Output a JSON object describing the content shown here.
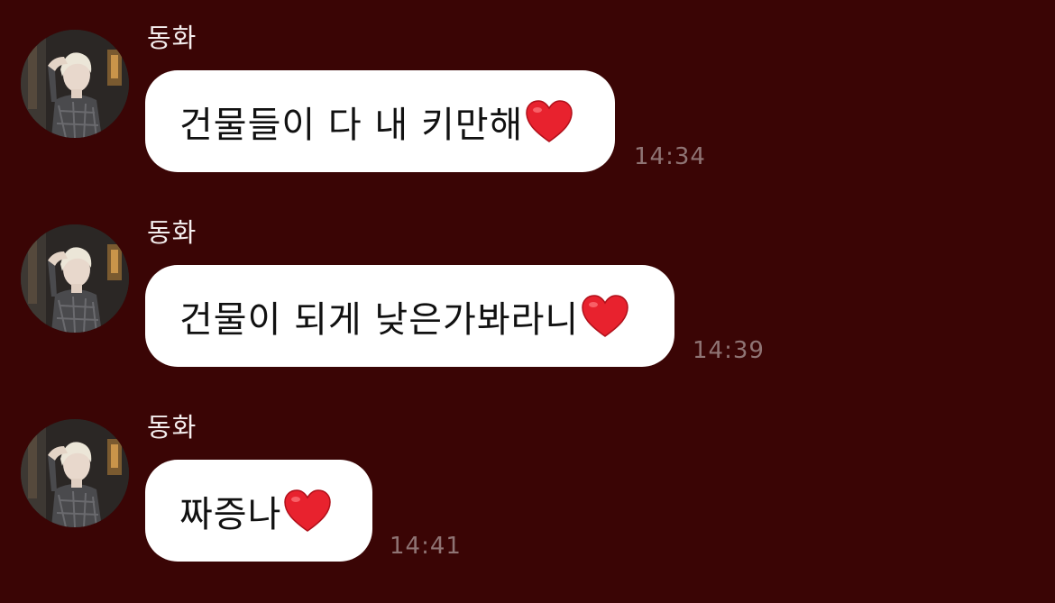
{
  "chat": {
    "messages": [
      {
        "sender": "동화",
        "text": "건물들이 다 내 키만해",
        "emoji": "heart-icon",
        "time": "14:34"
      },
      {
        "sender": "동화",
        "text": "건물이 되게 낮은가봐라니",
        "emoji": "heart-icon",
        "time": "14:39"
      },
      {
        "sender": "동화",
        "text": "짜증나",
        "emoji": "heart-icon",
        "time": "14:41"
      }
    ]
  },
  "colors": {
    "background": "#3a0505",
    "bubble": "#ffffff",
    "heart": "#e8222e",
    "timestamp": "#8f7474"
  }
}
